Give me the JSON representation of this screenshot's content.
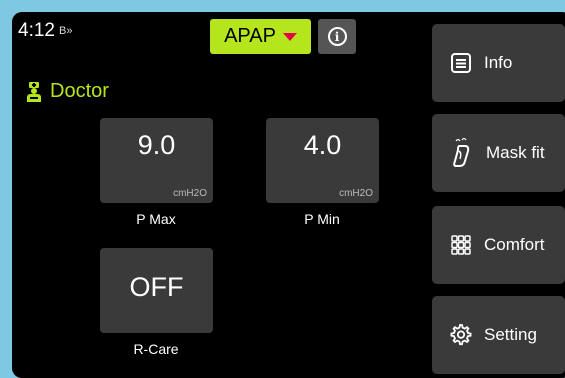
{
  "status": {
    "time": "4:12",
    "bluetooth_glyph": "B",
    "signal_glyph": "»"
  },
  "mode": {
    "label": "APAP",
    "accent_color": "#b5e61d",
    "caret_color": "#e40045"
  },
  "user": {
    "role": "Doctor",
    "icon": "doctor-icon"
  },
  "params": [
    {
      "value": "9.0",
      "unit": "cmH2O",
      "label": "P Max"
    },
    {
      "value": "4.0",
      "unit": "cmH2O",
      "label": "P Min"
    },
    {
      "value": "OFF",
      "unit": "",
      "label": "R-Care"
    }
  ],
  "menu": [
    {
      "label": "Info",
      "icon": "list-icon"
    },
    {
      "label": "Mask fit",
      "icon": "mask-icon"
    },
    {
      "label": "Comfort",
      "icon": "grid-icon"
    },
    {
      "label": "Setting",
      "icon": "gear-icon"
    }
  ]
}
